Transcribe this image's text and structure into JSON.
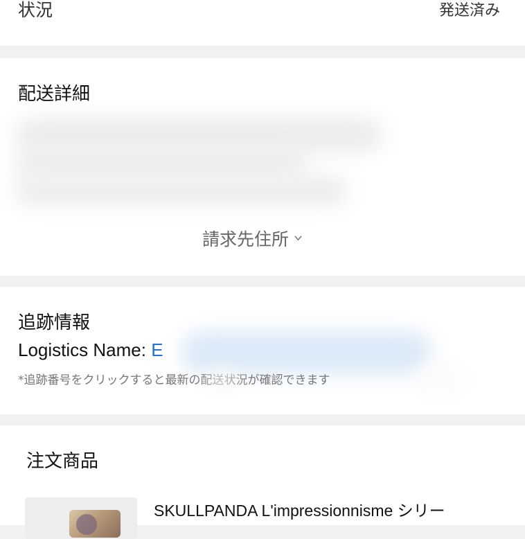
{
  "status": {
    "label": "状況",
    "value": "発送済み"
  },
  "shipping": {
    "title": "配送詳細",
    "billing_toggle": "請求先住所"
  },
  "tracking": {
    "title": "追跡情報",
    "logistics_label": "Logistics Name: ",
    "tracking_number_visible": "E",
    "note": "*追跡番号をクリックすると最新の配送状況が確認できます"
  },
  "items": {
    "title": "注文商品",
    "products": [
      {
        "title": "SKULLPANDA L'impressionnisme シリー"
      }
    ]
  },
  "colors": {
    "link": "#1e6fd9",
    "background": "#f2f2f2",
    "card": "#ffffff"
  }
}
